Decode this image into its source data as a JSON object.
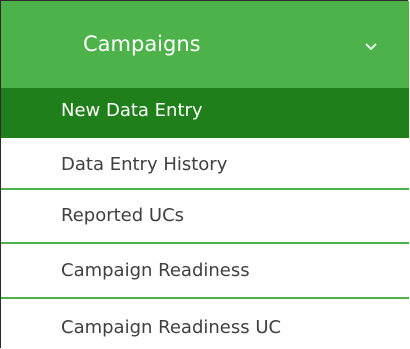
{
  "menu": {
    "header": {
      "title": "Campaigns",
      "chevron_icon": "chevron-down-icon"
    },
    "items": [
      {
        "label": "New Data Entry",
        "active": true
      },
      {
        "label": "Data Entry History",
        "active": false
      },
      {
        "label": "Reported UCs",
        "active": false
      },
      {
        "label": "Campaign Readiness",
        "active": false
      },
      {
        "label": "Campaign Readiness UC",
        "active": false
      }
    ]
  },
  "colors": {
    "header_bg": "#4db24a",
    "active_bg": "#1f7f1b",
    "divider": "#4db24a",
    "text": "#404040"
  }
}
